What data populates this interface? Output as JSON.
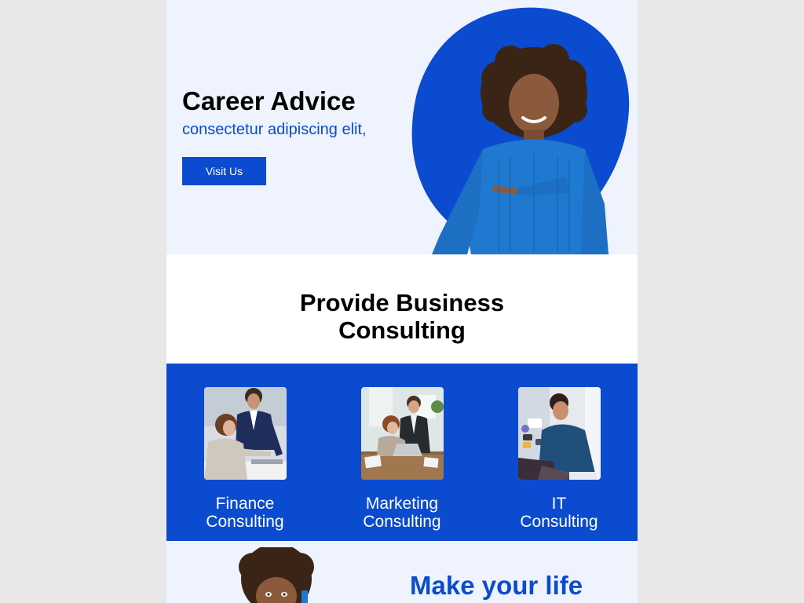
{
  "hero": {
    "title": "Career Advice",
    "subtitle": "consectetur adipiscing elit,",
    "button_label": "Visit Us",
    "accent_color": "#0a4bd0",
    "background_color": "#eef3fd",
    "image": "woman-pointing-photo"
  },
  "services": {
    "title_line1": "Provide Business",
    "title_line2": "Consulting",
    "background_color": "#0a4bd0",
    "items": [
      {
        "line1": "Finance",
        "line2": "Consulting",
        "image": "business-meeting-photo"
      },
      {
        "line1": "Marketing",
        "line2": "Consulting",
        "image": "team-at-table-photo"
      },
      {
        "line1": "IT",
        "line2": "Consulting",
        "image": "man-with-laptop-photo"
      }
    ]
  },
  "bottom": {
    "title": "Make your life",
    "image": "smiling-woman-photo"
  }
}
